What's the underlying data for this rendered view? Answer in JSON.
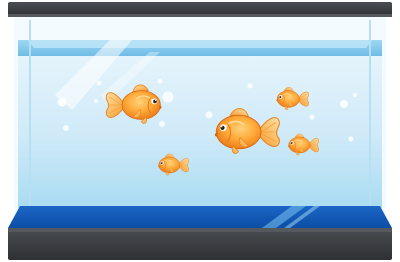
{
  "scene": {
    "subject": "aquarium",
    "fish_count": 5,
    "colors": {
      "background": "#ffffff",
      "frame_dark": "#3a3c3f",
      "frame_light": "#6b6e72",
      "water_top": "#e9f6fd",
      "water_mid": "#bfe4f6",
      "water_bottom": "#8ecfee",
      "gravel": "#0f57b3",
      "fish_body": "#f7941d",
      "fish_highlight": "#ffd27a",
      "fin": "#ffb347"
    },
    "icons": [
      "goldfish-icon",
      "bubble-icon"
    ]
  }
}
